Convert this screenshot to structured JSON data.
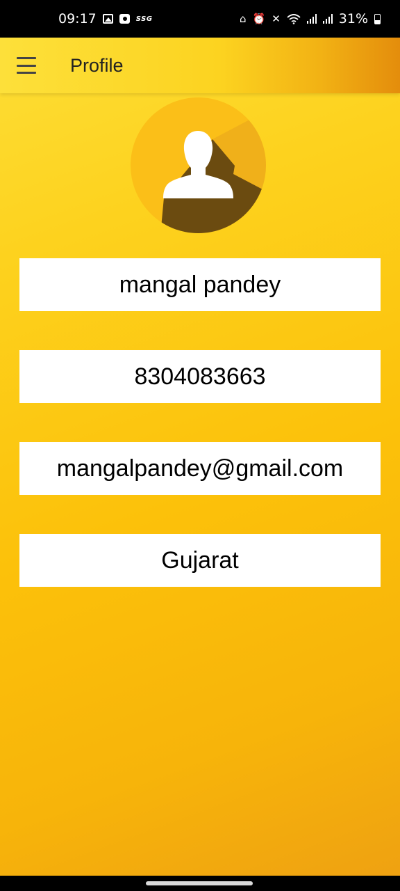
{
  "status_bar": {
    "time": "09:17",
    "ssg_label": "SSG",
    "battery": "31%"
  },
  "app_bar": {
    "title": "Profile"
  },
  "profile": {
    "name": "mangal pandey",
    "phone": "8304083663",
    "email": "mangalpandey@gmail.com",
    "state": "Gujarat"
  },
  "colors": {
    "background_top": "#fde03a",
    "background_bottom": "#eea012",
    "avatar_circle": "#fbbf18",
    "avatar_shadow": "#6b4b10",
    "field_background": "#ffffff",
    "status_bar": "#000000"
  },
  "icons": {
    "menu": "hamburger-menu-icon",
    "avatar": "user-silhouette-icon"
  }
}
